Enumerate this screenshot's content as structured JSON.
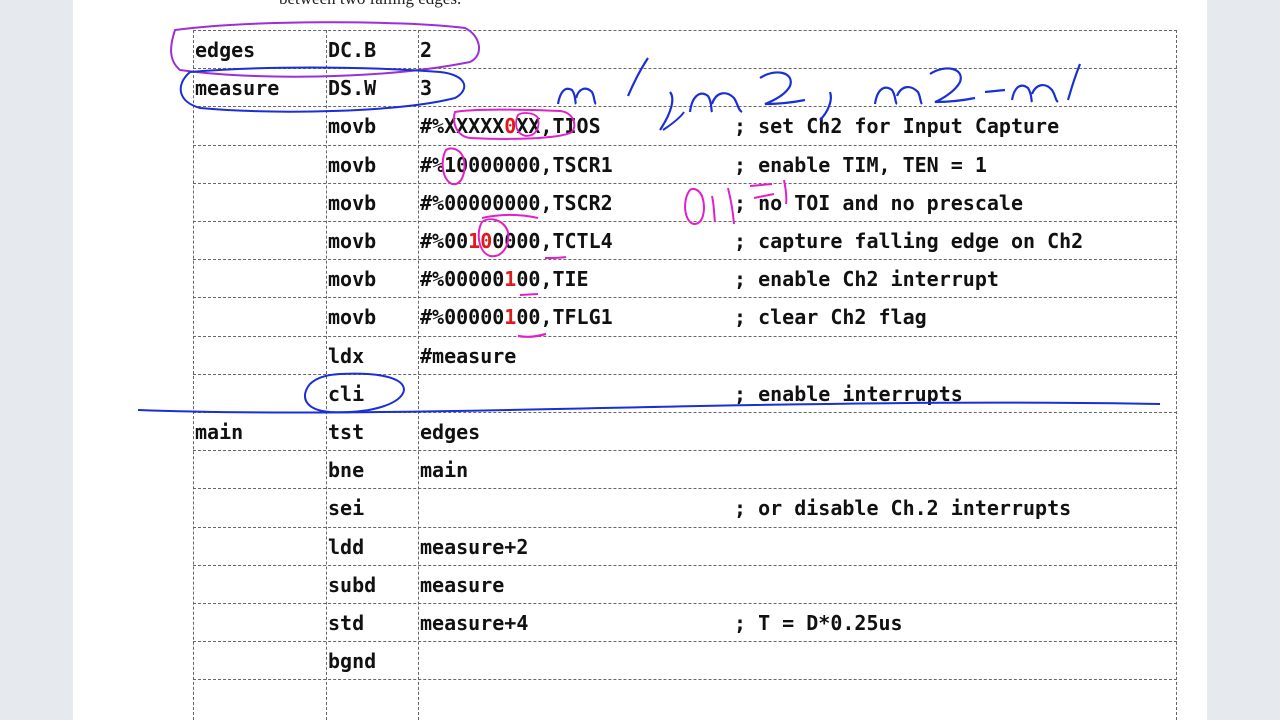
{
  "caption": "between two falling edges.",
  "rows": [
    {
      "label": "edges",
      "op": "DC.B",
      "arg": [
        "2"
      ],
      "comment": ""
    },
    {
      "label": "measure",
      "op": "DS.W",
      "arg": [
        "3"
      ],
      "comment": ""
    },
    {
      "label": "",
      "op": "movb",
      "arg": [
        "#%XXXXX",
        "0",
        "XX,TIOS"
      ],
      "comment": "; set Ch2 for Input Capture"
    },
    {
      "label": "",
      "op": "movb",
      "arg": [
        "#%10000000,TSCR1"
      ],
      "comment": "; enable TIM, TEN = 1"
    },
    {
      "label": "",
      "op": "movb",
      "arg": [
        "#%00000000,TSCR2"
      ],
      "comment": "; no TOI and no prescale"
    },
    {
      "label": "",
      "op": "movb",
      "arg": [
        "#%00",
        "10",
        "0000,TCTL4"
      ],
      "comment": "; capture falling edge on Ch2"
    },
    {
      "label": "",
      "op": "movb",
      "arg": [
        "#%00000",
        "1",
        "00,TIE"
      ],
      "comment": "; enable Ch2 interrupt"
    },
    {
      "label": "",
      "op": "movb",
      "arg": [
        "#%00000",
        "1",
        "00,TFLG1"
      ],
      "comment": "; clear Ch2 flag"
    },
    {
      "label": "",
      "op": "ldx",
      "arg": [
        "#measure"
      ],
      "comment": ""
    },
    {
      "label": "",
      "op": "cli",
      "arg": [
        ""
      ],
      "comment": "; enable interrupts"
    },
    {
      "label": "main",
      "op": "tst",
      "arg": [
        "edges"
      ],
      "comment": ""
    },
    {
      "label": "",
      "op": "bne",
      "arg": [
        "main"
      ],
      "comment": ""
    },
    {
      "label": "",
      "op": "sei",
      "arg": [
        ""
      ],
      "comment": "; or disable Ch.2 interrupts"
    },
    {
      "label": "",
      "op": "ldd",
      "arg": [
        "measure+2"
      ],
      "comment": ""
    },
    {
      "label": "",
      "op": "subd",
      "arg": [
        "measure"
      ],
      "comment": ""
    },
    {
      "label": "",
      "op": "std",
      "arg": [
        "measure+4"
      ],
      "comment": "; T = D*0.25us"
    },
    {
      "label": "",
      "op": "bgnd",
      "arg": [
        ""
      ],
      "comment": ""
    },
    {
      "label": "",
      "op": "",
      "arg": [
        ""
      ],
      "comment": ""
    }
  ],
  "colors": {
    "highlight_red": "#e01919",
    "ink_blue": "#1a2fd6",
    "ink_magenta": "#e020c8",
    "ink_purple": "#9b30d9"
  }
}
